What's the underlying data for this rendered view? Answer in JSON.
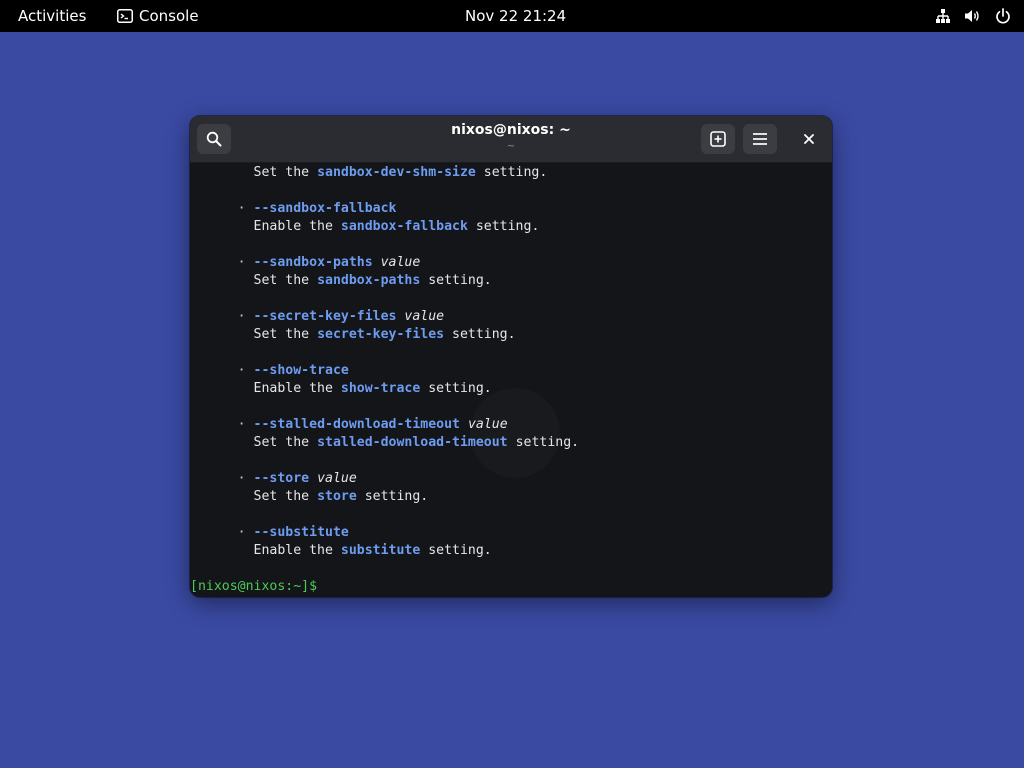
{
  "topbar": {
    "activities": "Activities",
    "app_name": "Console",
    "clock": "Nov 22  21:24",
    "icons": [
      "terminal-icon",
      "network-icon",
      "volume-icon",
      "power-icon"
    ]
  },
  "window": {
    "title": "nixos@nixos: ~",
    "subtitle": "~",
    "buttons": {
      "search": "search-icon",
      "new_tab": "new-tab-icon",
      "menu": "hamburger-menu-icon",
      "close": "close-icon"
    }
  },
  "terminal": {
    "entries": [
      {
        "bullet": "",
        "option": "",
        "arg": "",
        "desc_prefix": "Set the ",
        "setting": "sandbox-dev-shm-size",
        "desc_suffix": " setting."
      },
      {
        "bullet": "·",
        "option": "--sandbox-fallback",
        "arg": "",
        "desc_prefix": "Enable the ",
        "setting": "sandbox-fallback",
        "desc_suffix": " setting."
      },
      {
        "bullet": "·",
        "option": "--sandbox-paths",
        "arg": "value",
        "desc_prefix": "Set the ",
        "setting": "sandbox-paths",
        "desc_suffix": " setting."
      },
      {
        "bullet": "·",
        "option": "--secret-key-files",
        "arg": "value",
        "desc_prefix": "Set the ",
        "setting": "secret-key-files",
        "desc_suffix": " setting."
      },
      {
        "bullet": "·",
        "option": "--show-trace",
        "arg": "",
        "desc_prefix": "Enable the ",
        "setting": "show-trace",
        "desc_suffix": " setting."
      },
      {
        "bullet": "·",
        "option": "--stalled-download-timeout",
        "arg": "value",
        "desc_prefix": "Set the ",
        "setting": "stalled-download-timeout",
        "desc_suffix": " setting."
      },
      {
        "bullet": "·",
        "option": "--store",
        "arg": "value",
        "desc_prefix": "Set the ",
        "setting": "store",
        "desc_suffix": " setting."
      },
      {
        "bullet": "·",
        "option": "--substitute",
        "arg": "",
        "desc_prefix": "Enable the ",
        "setting": "substitute",
        "desc_suffix": " setting."
      }
    ],
    "prompt": "[nixos@nixos:~]$",
    "colors": {
      "option": "#6e9cf0",
      "prompt": "#4ec959",
      "text": "#e6e6e6",
      "background": "#131519"
    }
  },
  "desktop": {
    "background_color": "#3a4aa3"
  }
}
